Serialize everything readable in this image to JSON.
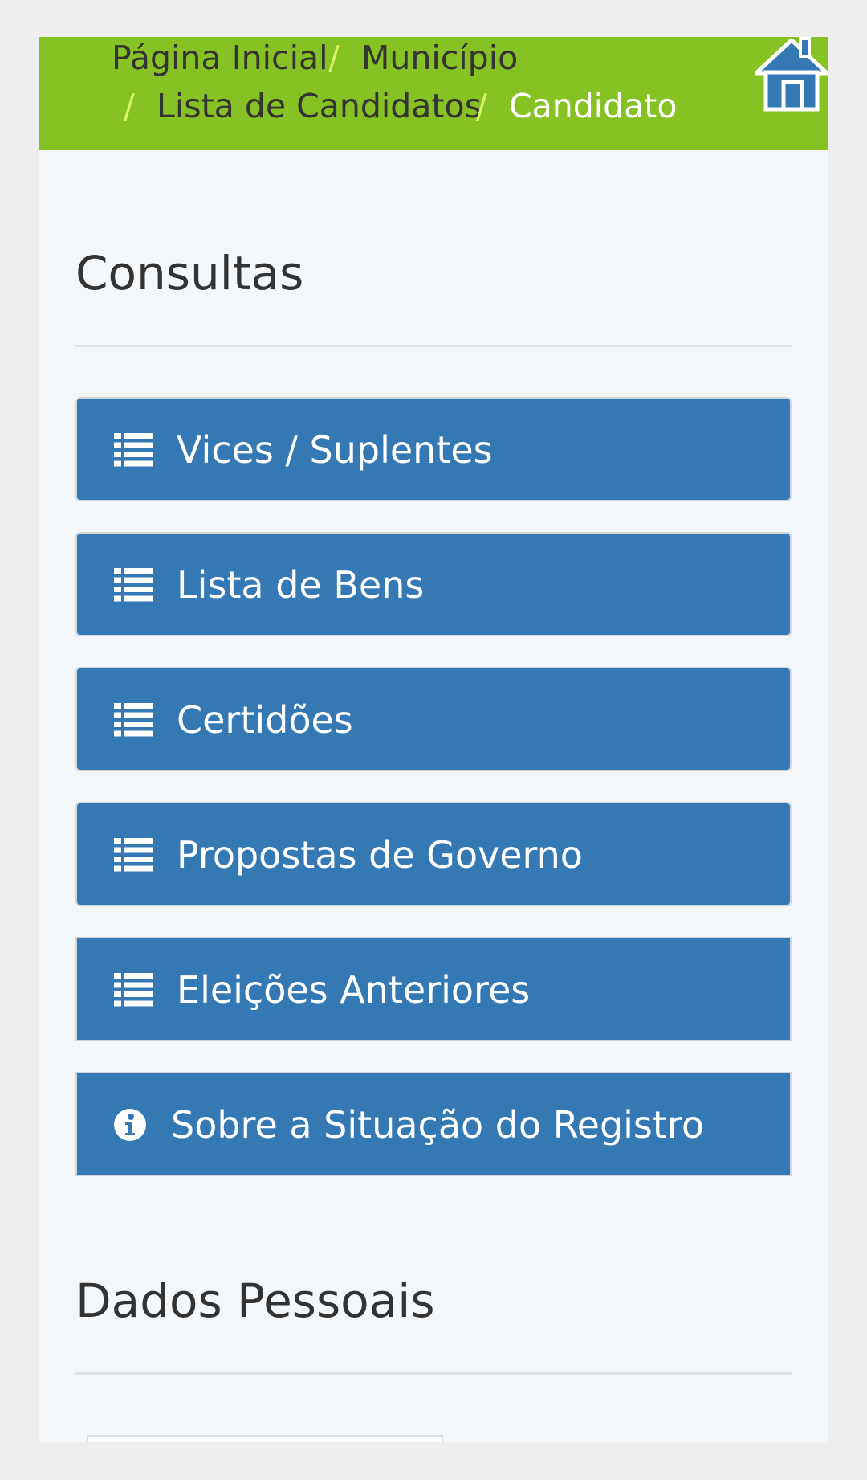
{
  "breadcrumb": {
    "items": [
      "Página Inicial",
      "Município",
      "Lista de Candidatos",
      "Candidato"
    ],
    "separator": "/",
    "home_icon": "home-icon"
  },
  "consultas": {
    "title": "Consultas",
    "buttons": [
      {
        "label": "Vices / Suplentes",
        "icon": "list-icon"
      },
      {
        "label": "Lista de Bens",
        "icon": "list-icon"
      },
      {
        "label": "Certidões",
        "icon": "list-icon"
      },
      {
        "label": "Propostas de Governo",
        "icon": "list-icon"
      },
      {
        "label": "Eleições Anteriores",
        "icon": "list-icon"
      },
      {
        "label": "Sobre a Situação do Registro",
        "icon": "info-circle-icon"
      }
    ]
  },
  "dados_pessoais": {
    "title": "Dados Pessoais"
  },
  "colors": {
    "header_green": "#87c225",
    "button_blue": "#3478b4",
    "page_background": "#f3f7fa",
    "separator_green": "#d8f56a"
  }
}
